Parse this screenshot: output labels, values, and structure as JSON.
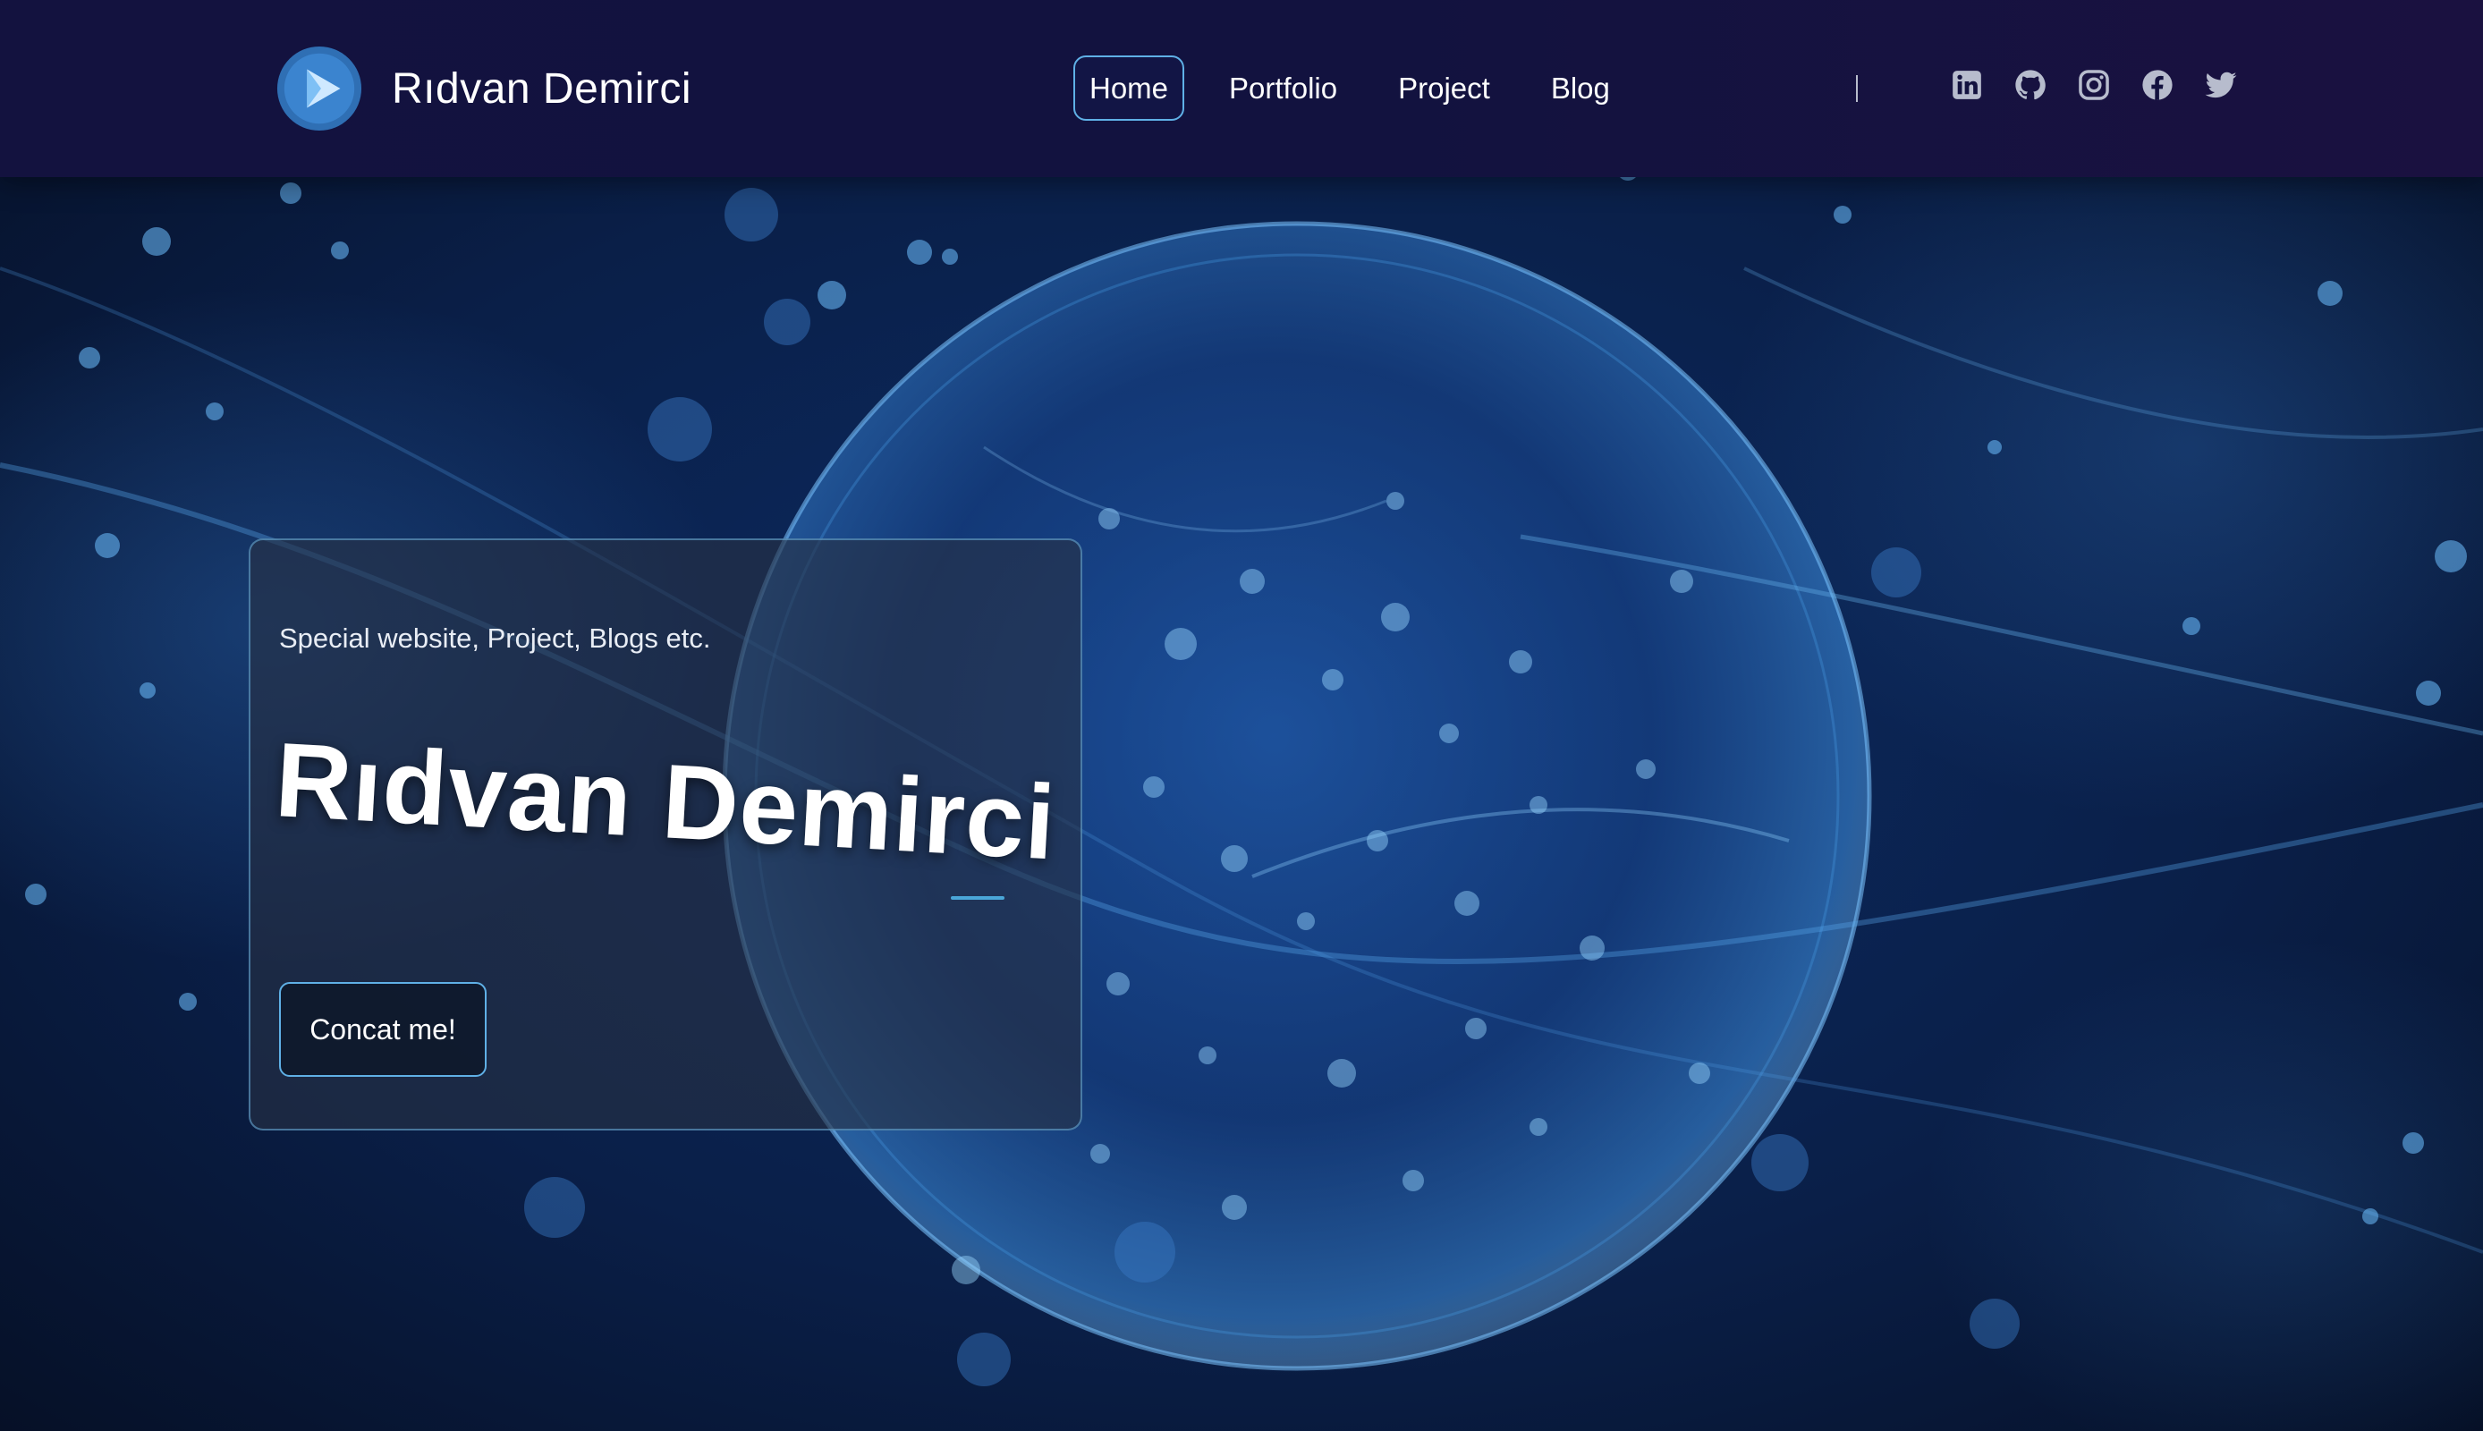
{
  "header": {
    "brand_name": "Rıdvan Demirci",
    "nav": [
      {
        "label": "Home",
        "active": true
      },
      {
        "label": "Portfolio",
        "active": false
      },
      {
        "label": "Project",
        "active": false
      },
      {
        "label": "Blog",
        "active": false
      }
    ],
    "divider": "|",
    "social_icons": [
      "linkedin-icon",
      "github-icon",
      "instagram-icon",
      "facebook-icon",
      "twitter-icon"
    ]
  },
  "hero": {
    "tagline": "Special website, Project, Blogs etc.",
    "title": "Rıdvan Demirci",
    "cta_label": "Concat me!"
  },
  "colors": {
    "header_bg": "#13123f",
    "accent": "#5fb0e6",
    "background": "#061226",
    "text": "#ffffff"
  }
}
